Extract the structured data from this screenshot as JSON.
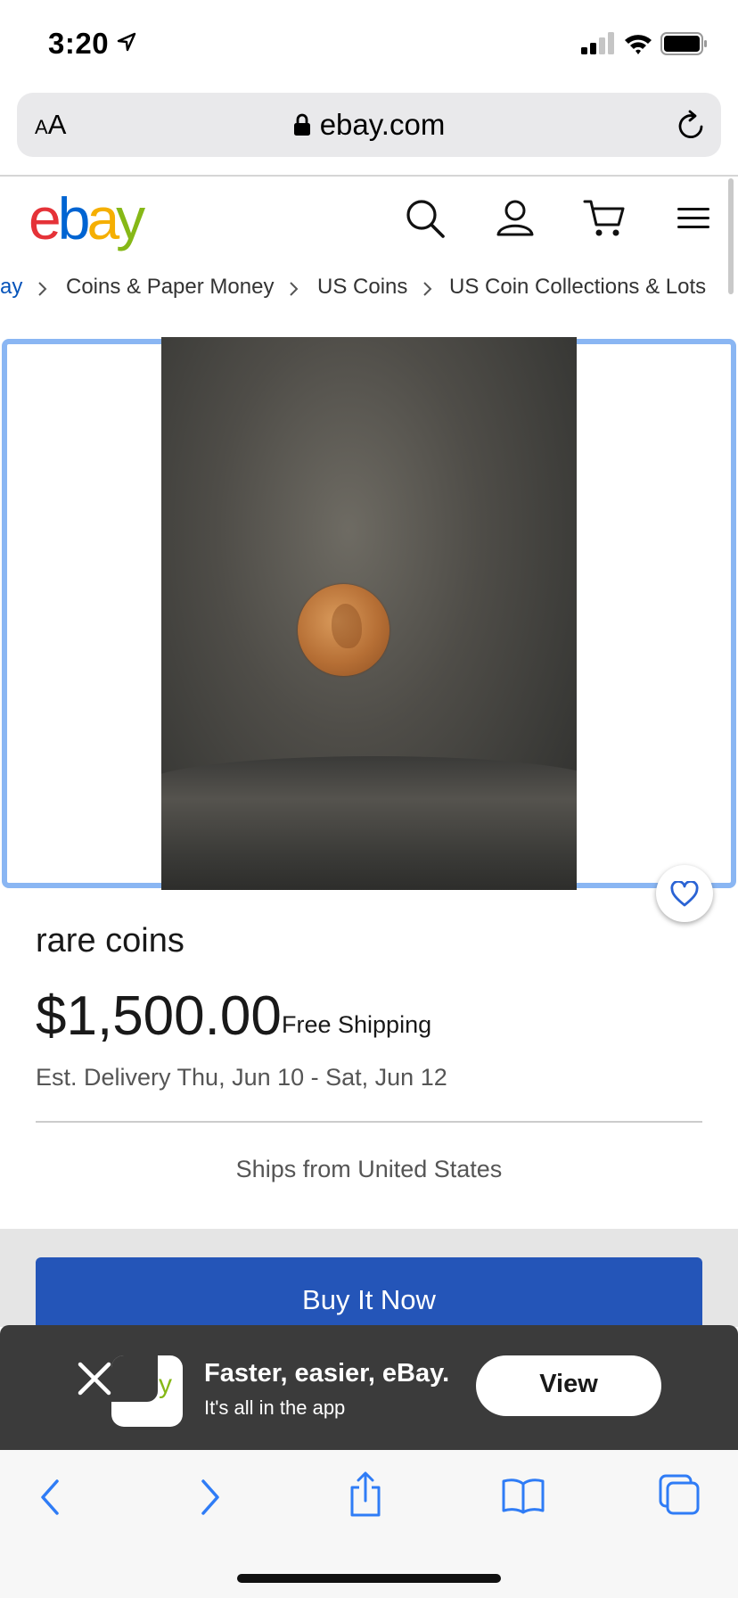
{
  "status_bar": {
    "time": "3:20",
    "icons": [
      "location-arrow-icon",
      "cellular-signal-icon",
      "wifi-icon",
      "battery-icon"
    ]
  },
  "url_bar": {
    "text_size_label_small": "A",
    "text_size_label_large": "A",
    "domain": "ebay.com",
    "icons": [
      "lock-icon",
      "reload-icon"
    ]
  },
  "header": {
    "logo": {
      "e": "e",
      "b": "b",
      "a": "a",
      "y": "y"
    },
    "logo_colors": [
      "#e53238",
      "#0064d2",
      "#f5af02",
      "#86b817"
    ],
    "icons": [
      "search-icon",
      "account-icon",
      "cart-icon",
      "menu-icon"
    ]
  },
  "breadcrumb": {
    "items": [
      "ay",
      "Coins & Paper Money",
      "US Coins",
      "US Coin Collections & Lots"
    ]
  },
  "item": {
    "title": "rare coins",
    "price": "$1,500.00",
    "shipping": "Free Shipping",
    "delivery": "Est. Delivery Thu, Jun 10 - Sat, Jun 12",
    "ships_from": "Ships from United States",
    "buy_now_label": "Buy It Now"
  },
  "app_banner": {
    "title": "Faster, easier, eBay.",
    "subtitle": "It's all in the app",
    "view_label": "View",
    "icon_glyph": "y"
  },
  "toolbar": {
    "icons": [
      "back-icon",
      "forward-icon",
      "share-icon",
      "bookmarks-icon",
      "tabs-icon"
    ]
  },
  "colors": {
    "ebay_blue": "#2455b8",
    "link_blue": "#0654ba",
    "image_border": "#8ab6f3",
    "banner_bg": "#3b3b3b"
  }
}
